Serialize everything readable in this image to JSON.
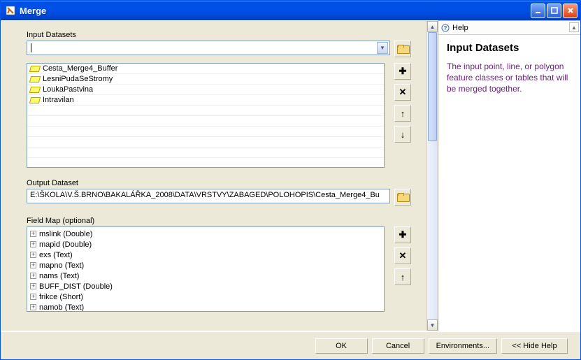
{
  "window": {
    "title": "Merge",
    "buttons": {
      "ok": "OK",
      "cancel": "Cancel",
      "env": "Environments...",
      "hidehelp": "<< Hide Help"
    }
  },
  "input_datasets": {
    "label": "Input Datasets",
    "value": "",
    "items": [
      "Cesta_Merge4_Buffer",
      "LesniPudaSeStromy",
      "LoukaPastvina",
      "Intravilan"
    ]
  },
  "output_dataset": {
    "label": "Output Dataset",
    "value": "E:\\ŠKOLA\\V.Š.BRNO\\BAKALÁŘKA_2008\\DATA\\VRSTVY\\ZABAGED\\POLOHOPIS\\Cesta_Merge4_Bu"
  },
  "field_map": {
    "label": "Field Map (optional)",
    "items": [
      "mslink (Double)",
      "mapid (Double)",
      "exs (Text)",
      "mapno (Text)",
      "nams (Text)",
      "BUFF_DIST (Double)",
      "frikce (Short)",
      "namob (Text)"
    ]
  },
  "help": {
    "header": "Help",
    "title": "Input Datasets",
    "text": "The input point, line, or polygon feature classes or tables that will be merged together."
  }
}
